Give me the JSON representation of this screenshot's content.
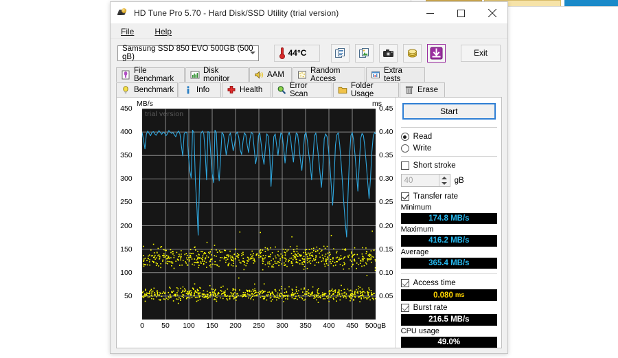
{
  "window": {
    "title": "HD Tune Pro 5.70 - Hard Disk/SSD Utility (trial version)",
    "app_icon": "hard-disk-icon",
    "minimize": "–",
    "maximize": "□",
    "close": "✕"
  },
  "menu": [
    {
      "label": "File",
      "mnemonic": "F"
    },
    {
      "label": "Help",
      "mnemonic": "H"
    }
  ],
  "toolbar": {
    "drive": "Samsung SSD 850 EVO 500GB (500 gB)",
    "temperature": "44°C",
    "buttons": [
      {
        "name": "copy-text-icon",
        "title": "Copy text"
      },
      {
        "name": "copy-image-icon",
        "title": "Copy image"
      },
      {
        "name": "screenshot-icon",
        "title": "Save screenshot"
      },
      {
        "name": "donate-icon",
        "title": "Buy"
      },
      {
        "name": "download-icon",
        "title": "Download"
      }
    ],
    "exit_label": "Exit"
  },
  "tabs_row1": [
    {
      "label": "File Benchmark",
      "icon": "file-benchmark-icon",
      "active": false
    },
    {
      "label": "Disk monitor",
      "icon": "disk-monitor-icon",
      "active": false
    },
    {
      "label": "AAM",
      "icon": "aam-speaker-icon",
      "active": false
    },
    {
      "label": "Random Access",
      "icon": "random-access-icon",
      "active": false
    },
    {
      "label": "Extra tests",
      "icon": "extra-tests-icon",
      "active": false
    }
  ],
  "tabs_row2": [
    {
      "label": "Benchmark",
      "icon": "benchmark-bulb-icon",
      "active": true
    },
    {
      "label": "Info",
      "icon": "info-icon",
      "active": false
    },
    {
      "label": "Health",
      "icon": "health-cross-icon",
      "active": false
    },
    {
      "label": "Error Scan",
      "icon": "error-scan-magnifier-icon",
      "active": false
    },
    {
      "label": "Folder Usage",
      "icon": "folder-usage-icon",
      "active": false
    },
    {
      "label": "Erase",
      "icon": "erase-trash-icon",
      "active": false
    }
  ],
  "panel": {
    "start_label": "Start",
    "mode": [
      {
        "label": "Read",
        "selected": true
      },
      {
        "label": "Write",
        "selected": false
      }
    ],
    "short_stroke": {
      "label": "Short stroke",
      "checked": false,
      "value": "40",
      "unit": "gB"
    },
    "transfer_rate": {
      "label": "Transfer rate",
      "checked": true
    },
    "results": [
      {
        "label": "Minimum",
        "value": "174.8 MB/s",
        "color": "cyan"
      },
      {
        "label": "Maximum",
        "value": "416.2 MB/s",
        "color": "cyan"
      },
      {
        "label": "Average",
        "value": "365.4 MB/s",
        "color": "cyan"
      }
    ],
    "access_time": {
      "label": "Access time",
      "checked": true,
      "value": "0.080",
      "unit": "ms"
    },
    "burst_rate": {
      "label": "Burst rate",
      "checked": true,
      "value": "216.5 MB/s"
    },
    "cpu_usage": {
      "label": "CPU usage",
      "value": "49.0%"
    }
  },
  "chart_data": {
    "type": "line",
    "title": "",
    "watermark": "trial version",
    "xlabel": "",
    "ylabel": "MB/s",
    "y2label": "ms",
    "xlim": [
      0,
      500
    ],
    "ylim": [
      0,
      450
    ],
    "y2lim": [
      0.0,
      0.45
    ],
    "grid": true,
    "legend": "none",
    "x_ticks": [
      "0",
      "50",
      "100",
      "150",
      "200",
      "250",
      "300",
      "350",
      "400",
      "450",
      "500gB"
    ],
    "x_tick_values": [
      0,
      50,
      100,
      150,
      200,
      250,
      300,
      350,
      400,
      450,
      500
    ],
    "y_ticks": [
      "450",
      "400",
      "350",
      "300",
      "250",
      "200",
      "150",
      "100",
      "50"
    ],
    "y_tick_values": [
      450,
      400,
      350,
      300,
      250,
      200,
      150,
      100,
      50
    ],
    "y2_ticks": [
      "0.45",
      "0.40",
      "0.35",
      "0.30",
      "0.25",
      "0.20",
      "0.15",
      "0.10",
      "0.05"
    ],
    "y2_tick_values": [
      0.45,
      0.4,
      0.35,
      0.3,
      0.25,
      0.2,
      0.15,
      0.1,
      0.05
    ],
    "series": [
      {
        "name": "Transfer rate",
        "axis": "left",
        "units": "MB/s",
        "color": "#2fa8e0",
        "x": [
          0,
          3,
          6,
          9,
          12,
          15,
          18,
          21,
          24,
          27,
          30,
          33,
          36,
          39,
          42,
          45,
          48,
          51,
          54,
          57,
          60,
          63,
          66,
          69,
          72,
          75,
          78,
          81,
          84,
          87,
          90,
          93,
          96,
          99,
          102,
          105,
          108,
          111,
          114,
          117,
          120,
          123,
          126,
          129,
          132,
          135,
          138,
          141,
          144,
          147,
          150,
          153,
          156,
          159,
          162,
          165,
          168,
          171,
          174,
          177,
          180,
          183,
          186,
          189,
          192,
          195,
          198,
          201,
          204,
          207,
          210,
          213,
          216,
          219,
          222,
          225,
          228,
          231,
          234,
          237,
          240,
          243,
          246,
          249,
          252,
          255,
          258,
          261,
          264,
          267,
          270,
          273,
          276,
          279,
          282,
          285,
          288,
          291,
          294,
          297,
          300,
          303,
          306,
          309,
          312,
          315,
          318,
          321,
          324,
          327,
          330,
          333,
          336,
          339,
          342,
          345,
          348,
          351,
          354,
          357,
          360,
          363,
          366,
          369,
          372,
          375,
          378,
          381,
          384,
          387,
          390,
          393,
          396,
          399,
          402,
          405,
          408,
          411,
          414,
          417,
          420,
          423,
          426,
          429,
          432,
          435,
          438,
          441,
          444,
          447,
          450,
          453,
          456,
          459,
          462,
          465,
          468,
          471,
          474,
          477,
          480,
          483,
          486,
          489,
          492,
          495,
          498,
          500
        ],
        "y": [
          399,
          383,
          364,
          395,
          402,
          397,
          392,
          399,
          401,
          396,
          393,
          398,
          403,
          399,
          395,
          400,
          398,
          392,
          396,
          403,
          400,
          397,
          399,
          394,
          390,
          398,
          402,
          396,
          371,
          349,
          396,
          400,
          398,
          352,
          318,
          302,
          404,
          398,
          296,
          245,
          180,
          300,
          397,
          402,
          396,
          358,
          298,
          401,
          399,
          352,
          311,
          292,
          404,
          398,
          324,
          296,
          345,
          399,
          395,
          378,
          351,
          369,
          392,
          398,
          382,
          360,
          374,
          396,
          400,
          388,
          362,
          352,
          380,
          398,
          394,
          372,
          356,
          386,
          399,
          396,
          364,
          332,
          349,
          392,
          398,
          374,
          348,
          331,
          367,
          396,
          391,
          358,
          284,
          338,
          390,
          396,
          372,
          350,
          376,
          398,
          394,
          366,
          334,
          360,
          392,
          399,
          386,
          358,
          336,
          372,
          398,
          395,
          370,
          340,
          318,
          356,
          394,
          399,
          380,
          352,
          330,
          298,
          346,
          392,
          398,
          372,
          344,
          312,
          282,
          324,
          386,
          396,
          390,
          362,
          330,
          286,
          244,
          300,
          372,
          394,
          398,
          374,
          336,
          292,
          248,
          206,
          176,
          268,
          346,
          392,
          399,
          382,
          350,
          312,
          274,
          330,
          386,
          397,
          392,
          368,
          332,
          294,
          258,
          300,
          358,
          392,
          399,
          396,
          392,
          399
        ]
      },
      {
        "name": "Access time (upper scatter band)",
        "axis": "right",
        "units": "ms",
        "color": "#ffff00",
        "type": "scatter",
        "approx_range_ms": [
          0.1,
          0.165
        ],
        "note": "dense yellow dot cloud centred near 0.120 ms spanning the full 0-500 gB span"
      },
      {
        "name": "Access time (lower scatter band)",
        "axis": "right",
        "units": "ms",
        "color": "#ffff00",
        "type": "scatter",
        "approx_range_ms": [
          0.035,
          0.075
        ],
        "note": "dense yellow dot cloud centred near 0.050 ms spanning the full 0-500 gB span"
      }
    ]
  }
}
